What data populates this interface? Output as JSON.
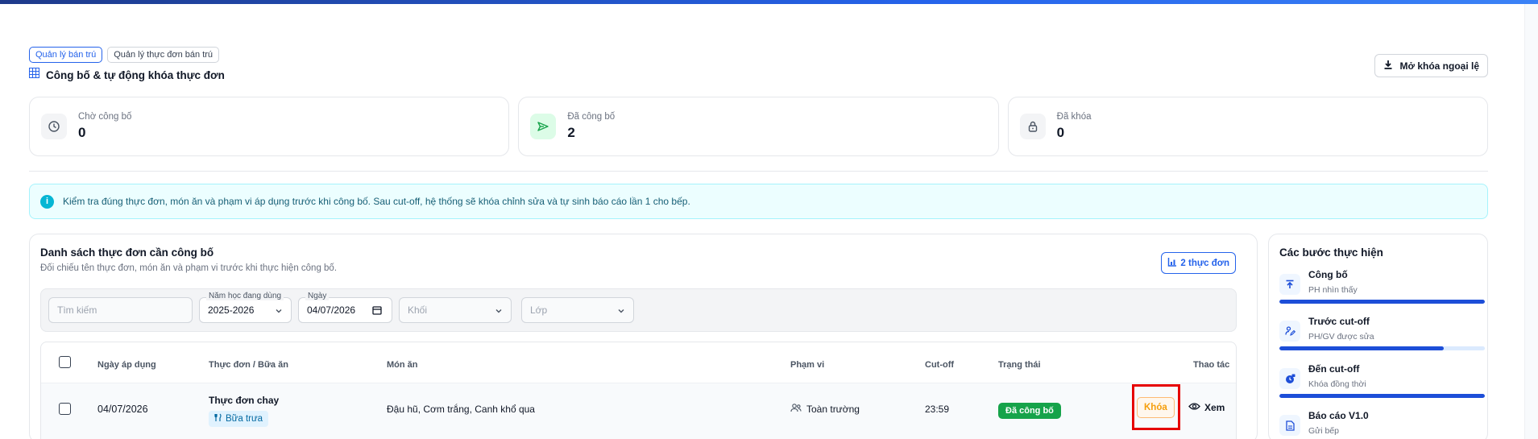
{
  "breadcrumbs": [
    {
      "label": "Quản lý bán trú",
      "active": true
    },
    {
      "label": "Quản lý thực đơn bán trú",
      "active": false
    }
  ],
  "page": {
    "title": "Công bố & tự động khóa thực đơn",
    "unlock_button": "Mở khóa ngoại lệ"
  },
  "stats": [
    {
      "label": "Chờ công bố",
      "value": "0",
      "icon": "clock-icon"
    },
    {
      "label": "Đã công bố",
      "value": "2",
      "icon": "send-icon"
    },
    {
      "label": "Đã khóa",
      "value": "0",
      "icon": "lock-icon"
    }
  ],
  "alert": {
    "text": "Kiểm tra đúng thực đơn, món ăn và phạm vi áp dụng trước khi công bố. Sau cut-off, hệ thống sẽ khóa chỉnh sửa và tự sinh báo cáo lần 1 cho bếp."
  },
  "list": {
    "title": "Danh sách thực đơn cần công bố",
    "subtitle": "Đối chiếu tên thực đơn, món ăn và phạm vi trước khi thực hiện công bố.",
    "count_label": "2 thực đơn"
  },
  "filters": {
    "search_placeholder": "Tìm kiếm",
    "school_year_label": "Năm học đang dùng",
    "school_year_value": "2025-2026",
    "date_label": "Ngày",
    "date_value": "04/07/2026",
    "grade_placeholder": "Khối",
    "class_placeholder": "Lớp"
  },
  "table": {
    "headers": {
      "date": "Ngày áp dụng",
      "menu": "Thực đơn / Bữa ăn",
      "dishes": "Món ăn",
      "scope": "Phạm vi",
      "cutoff": "Cut-off",
      "status": "Trạng thái",
      "actions": "Thao tác"
    },
    "rows": [
      {
        "date": "04/07/2026",
        "menu_name": "Thực đơn chay",
        "meal": "Bữa trưa",
        "dishes": "Đậu hũ, Cơm trắng, Canh khổ qua",
        "scope": "Toàn trường",
        "cutoff": "23:59",
        "status": "Đã công bố",
        "lock_label": "Khóa",
        "view_label": "Xem"
      }
    ]
  },
  "steps": {
    "title": "Các bước thực hiện",
    "items": [
      {
        "title": "Công bố",
        "desc": "PH nhìn thấy",
        "progress": 1.0,
        "icon": "upload-icon"
      },
      {
        "title": "Trước cut-off",
        "desc": "PH/GV được sửa",
        "progress": 0.8,
        "icon": "user-edit-icon"
      },
      {
        "title": "Đến cut-off",
        "desc": "Khóa đồng thời",
        "progress": 1.0,
        "icon": "clock-lock-icon"
      },
      {
        "title": "Báo cáo V1.0",
        "desc": "Gửi bếp",
        "progress": 0,
        "icon": "report-icon"
      }
    ]
  },
  "colors": {
    "primary": "#2563eb",
    "success": "#16a34a",
    "warning": "#f59e0b",
    "highlight": "#e60000"
  }
}
